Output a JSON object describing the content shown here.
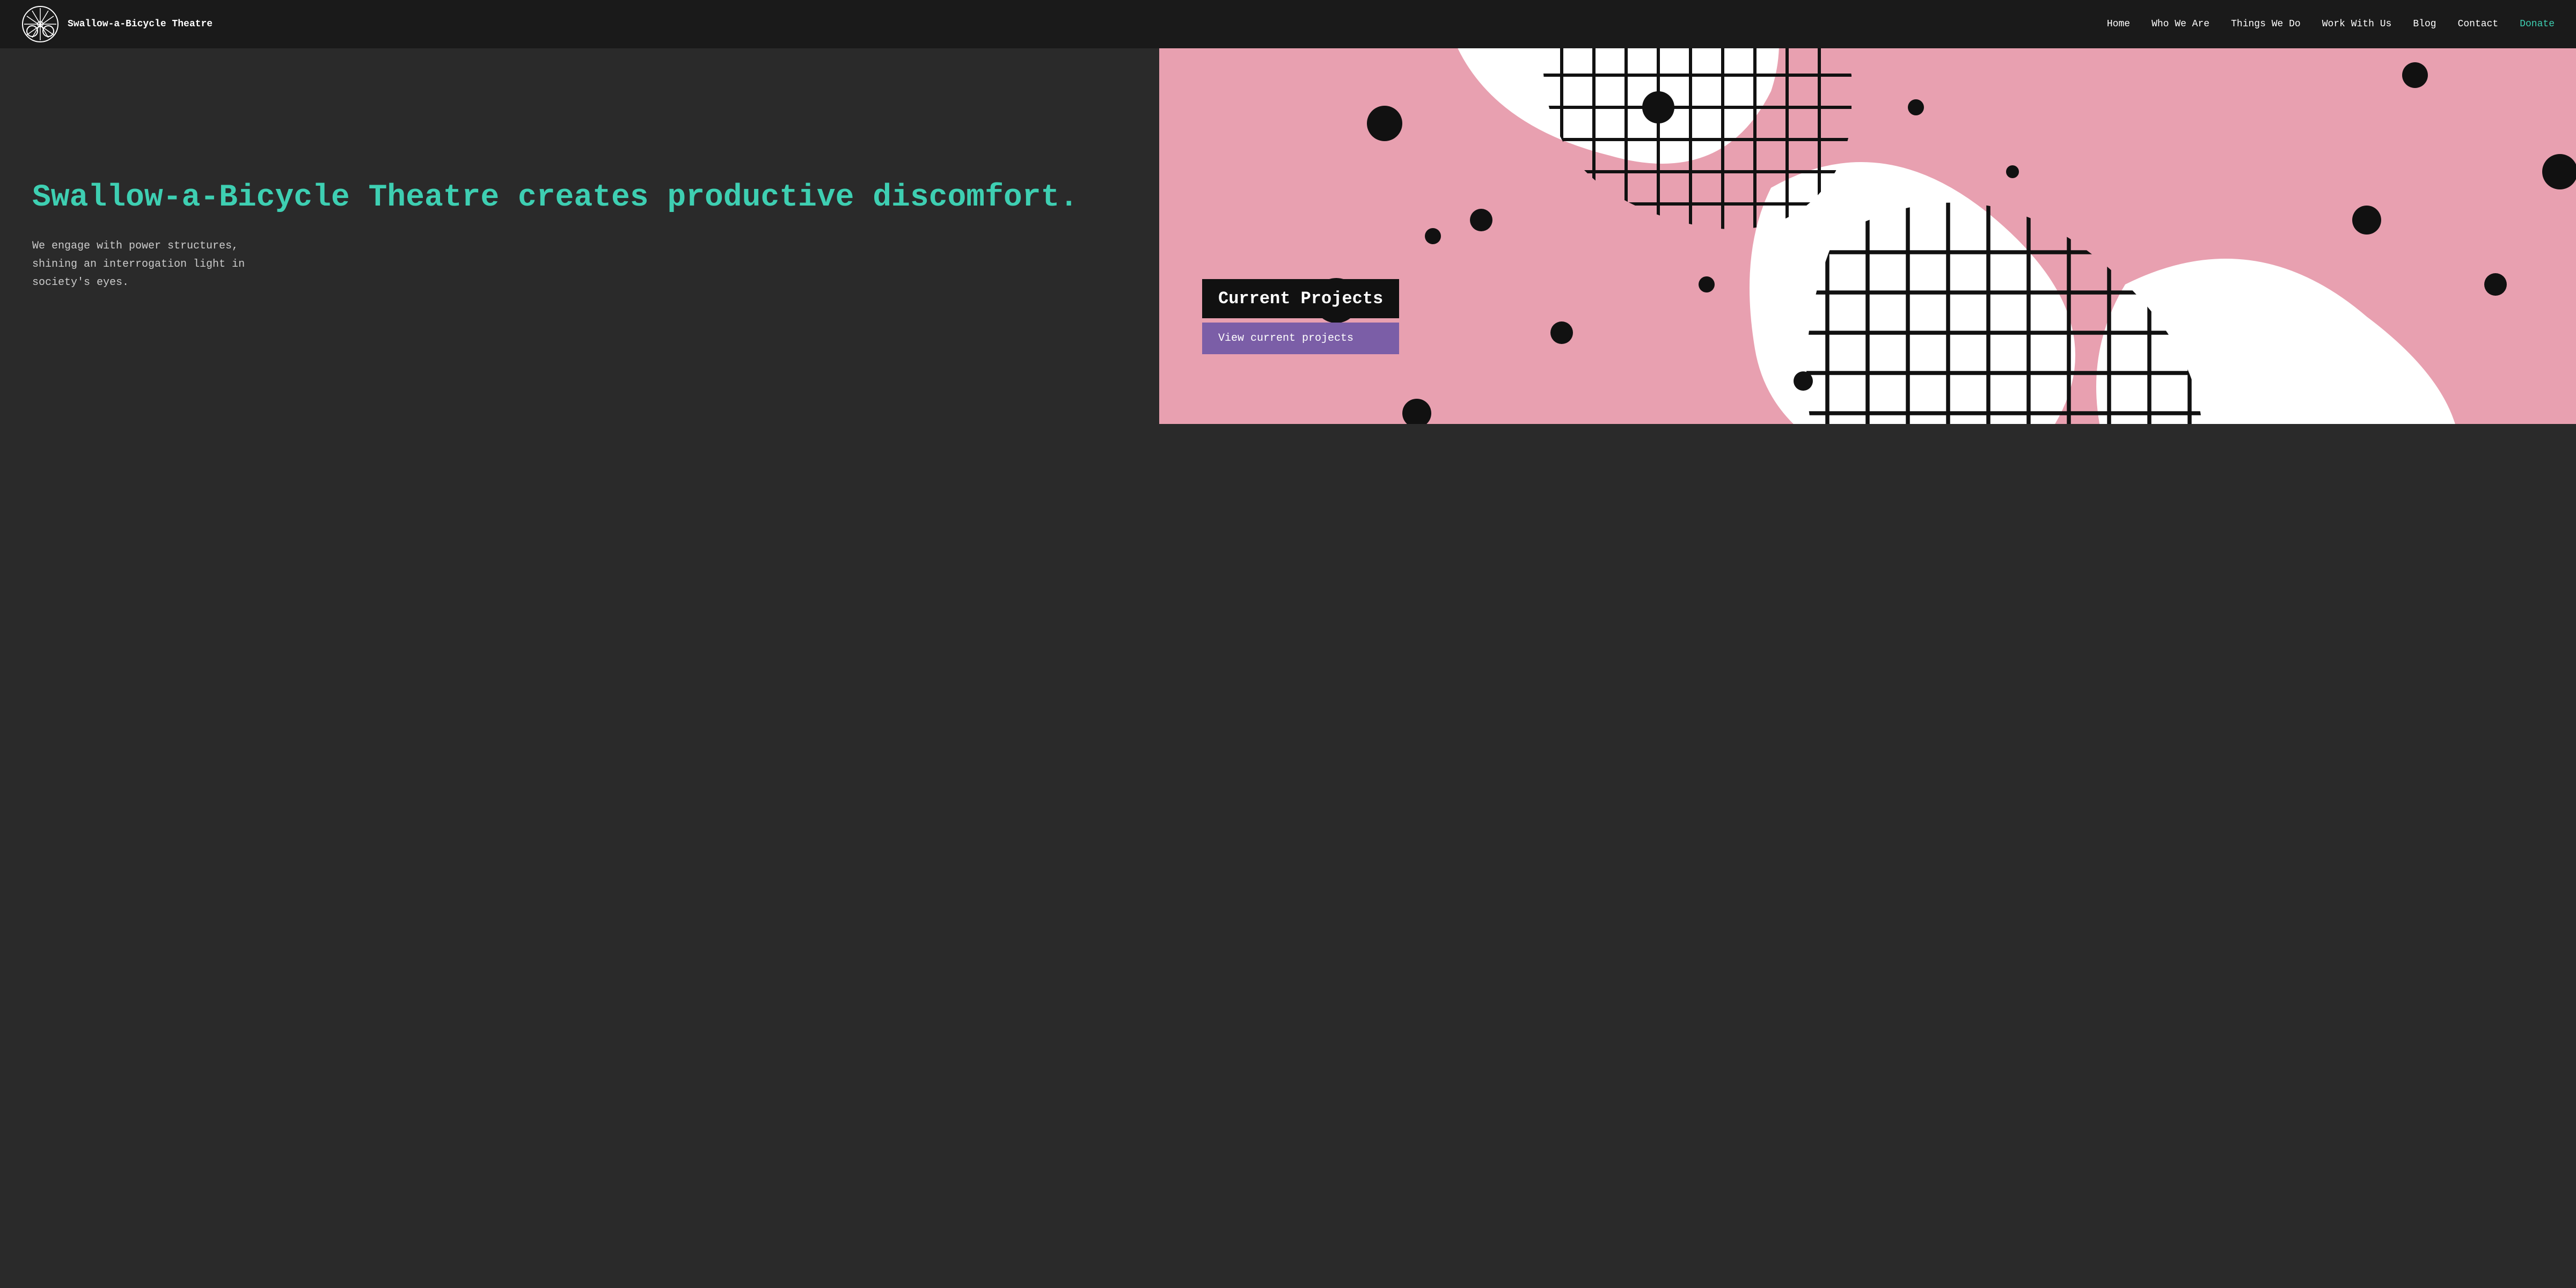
{
  "nav": {
    "logo_text": "Swallow-a-Bicycle Theatre",
    "links": [
      {
        "label": "Home",
        "href": "#",
        "class": ""
      },
      {
        "label": "Who We Are",
        "href": "#",
        "class": ""
      },
      {
        "label": "Things We Do",
        "href": "#",
        "class": ""
      },
      {
        "label": "Work With Us",
        "href": "#",
        "class": ""
      },
      {
        "label": "Blog",
        "href": "#",
        "class": ""
      },
      {
        "label": "Contact",
        "href": "#",
        "class": ""
      },
      {
        "label": "Donate",
        "href": "#",
        "class": "donate"
      }
    ]
  },
  "hero": {
    "title": "Swallow-a-Bicycle Theatre creates productive discomfort.",
    "subtitle": "We engage with power structures, shining an interrogation light in society's eyes.",
    "current_projects_label": "Current Projects",
    "view_btn_label": "View current projects"
  },
  "colors": {
    "bg_dark": "#2a2a2a",
    "nav_bg": "#1a1a1a",
    "accent_teal": "#3ecfb2",
    "accent_purple": "#7b5ea7",
    "art_pink": "#e8a0b0",
    "art_teal": "#3ecfb2",
    "art_black": "#111111",
    "art_white": "#f5f5f5"
  }
}
